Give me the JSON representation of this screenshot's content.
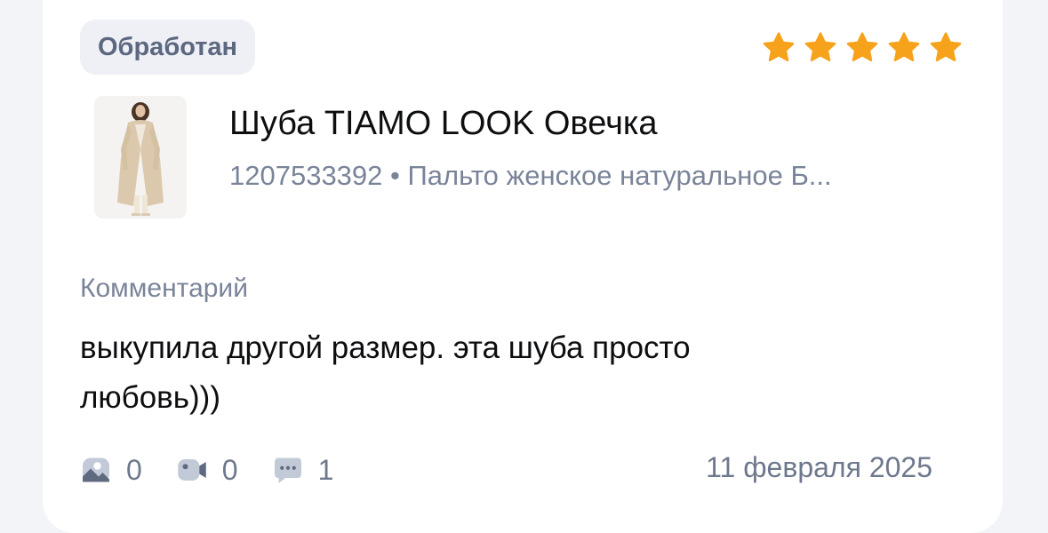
{
  "review": {
    "status": "Обработан",
    "rating": 5,
    "rating_color": "#f7a21b",
    "product": {
      "title": "Шуба TIAMO LOOK Овечка",
      "subtitle": "1207533392 • Пальто женское натуральное Б..."
    },
    "comment_label": "Комментарий",
    "comment_text": "выкупила другой размер. эта шуба просто любовь)))",
    "photos_count": "0",
    "videos_count": "0",
    "replies_count": "1",
    "date": "11 февраля 2025"
  },
  "icons": {
    "photo": "photo-icon",
    "video": "video-icon",
    "comment": "comment-icon",
    "star": "star-icon"
  }
}
